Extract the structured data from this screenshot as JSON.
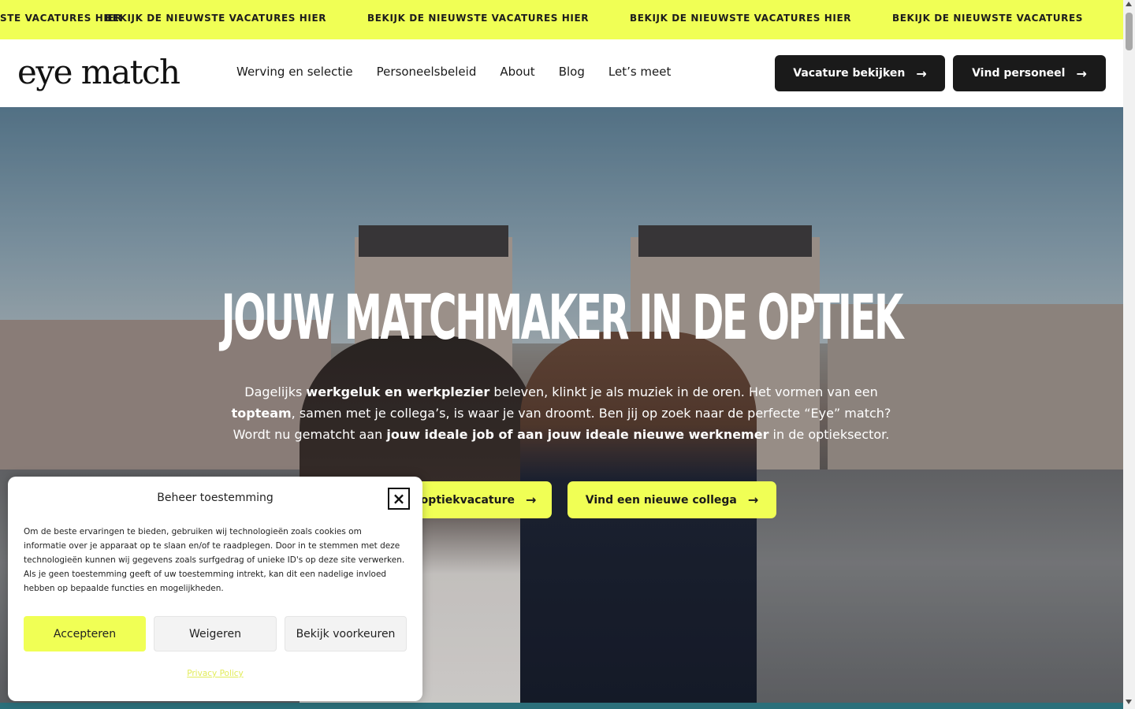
{
  "ticker": {
    "items": [
      "STE VACATURES HIER",
      "BEKIJK DE NIEUWSTE VACATURES HIER",
      "BEKIJK DE NIEUWSTE VACATURES HIER",
      "BEKIJK DE NIEUWSTE VACATURES HIER",
      "BEKIJK DE NIEUWSTE VACATURES"
    ],
    "background": "#f0ff55"
  },
  "header": {
    "logo": "eye match",
    "nav": [
      "Werving en selectie",
      "Personeelsbeleid",
      "About",
      "Blog",
      "Let’s meet"
    ],
    "buttons": [
      "Vacature bekijken",
      "Vind personeel"
    ],
    "arrow": "→"
  },
  "hero": {
    "title": "JOUW MATCHMAKER IN DE OPTIEK",
    "text_parts": [
      "Dagelijks ",
      "werkgeluk en werkplezier",
      " beleven, klinkt je als muziek in de oren. Het vormen van een ",
      "topteam",
      ", samen met je collega’s, is waar je van droomt. Ben jij op zoek naar de perfecte “Eye” match? Wordt nu gematcht aan ",
      "jouw ideale job of aan jouw ideale nieuwe werknemer",
      " in de optieksector."
    ],
    "buttons": [
      "Vind een optiekvacature",
      "Vind een nieuwe collega"
    ],
    "accent": "#f0ff55"
  },
  "consent": {
    "title": "Beheer toestemming",
    "close": "×",
    "body": "Om de beste ervaringen te bieden, gebruiken wij technologieën zoals cookies om informatie over je apparaat op te slaan en/of te raadplegen. Door in te stemmen met deze technologieën kunnen wij gegevens zoals surfgedrag of unieke ID's op deze site verwerken. Als je geen toestemming geeft of uw toestemming intrekt, kan dit een nadelige invloed hebben op bepaalde functies en mogelijkheden.",
    "buttons": {
      "accept": "Accepteren",
      "deny": "Weigeren",
      "prefs": "Bekijk voorkeuren"
    },
    "privacy": "Privacy Policy"
  }
}
